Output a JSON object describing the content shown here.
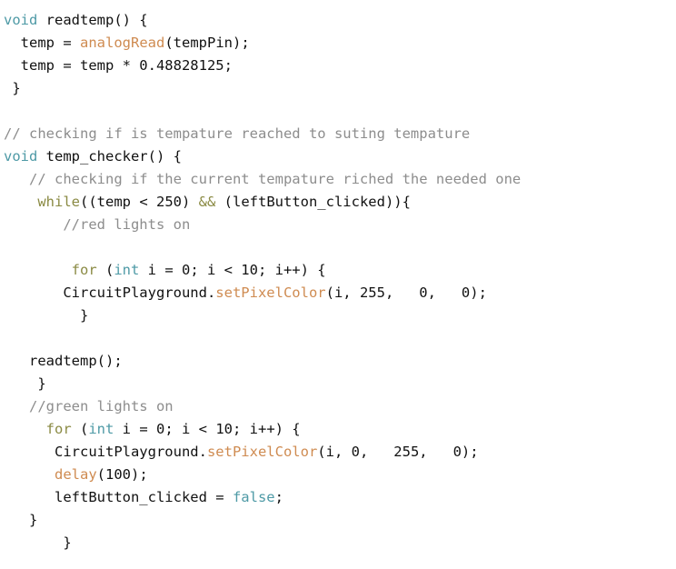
{
  "editor": {
    "language": "arduino-cpp",
    "background_color": "#ffffff",
    "colors": {
      "plain": "#111111",
      "keyword": "#4e9aa6",
      "control": "#8a8a43",
      "function": "#cf8b51",
      "comment": "#8d8d8d",
      "literal": "#4e9aa6"
    },
    "lines": [
      {
        "id": 1,
        "tokens": [
          {
            "t": "void",
            "c": "keyword"
          },
          {
            "t": " readtemp() {",
            "c": "plain"
          }
        ]
      },
      {
        "id": 2,
        "tokens": [
          {
            "t": "  temp = ",
            "c": "plain"
          },
          {
            "t": "analogRead",
            "c": "function"
          },
          {
            "t": "(tempPin);",
            "c": "plain"
          }
        ]
      },
      {
        "id": 3,
        "tokens": [
          {
            "t": "  temp = temp * 0.48828125;",
            "c": "plain"
          }
        ]
      },
      {
        "id": 4,
        "tokens": [
          {
            "t": " }",
            "c": "plain"
          }
        ]
      },
      {
        "id": 5,
        "tokens": []
      },
      {
        "id": 6,
        "tokens": [
          {
            "t": "// checking if is tempature reached to suting tempature",
            "c": "comment"
          }
        ]
      },
      {
        "id": 7,
        "tokens": [
          {
            "t": "void",
            "c": "keyword"
          },
          {
            "t": " temp_checker() {",
            "c": "plain"
          }
        ]
      },
      {
        "id": 8,
        "tokens": [
          {
            "t": "   // checking if the current tempature riched the needed one",
            "c": "comment"
          }
        ]
      },
      {
        "id": 9,
        "tokens": [
          {
            "t": "    ",
            "c": "plain"
          },
          {
            "t": "while",
            "c": "control"
          },
          {
            "t": "((temp < 250) ",
            "c": "plain"
          },
          {
            "t": "&&",
            "c": "control"
          },
          {
            "t": " (leftButton_clicked)){",
            "c": "plain"
          }
        ]
      },
      {
        "id": 10,
        "tokens": [
          {
            "t": "       //red lights on",
            "c": "comment"
          }
        ]
      },
      {
        "id": 11,
        "tokens": []
      },
      {
        "id": 12,
        "tokens": [
          {
            "t": "        ",
            "c": "plain"
          },
          {
            "t": "for",
            "c": "control"
          },
          {
            "t": " (",
            "c": "plain"
          },
          {
            "t": "int",
            "c": "keyword"
          },
          {
            "t": " i = 0; i < 10; i++) {",
            "c": "plain"
          }
        ]
      },
      {
        "id": 13,
        "tokens": [
          {
            "t": "       CircuitPlayground.",
            "c": "plain"
          },
          {
            "t": "setPixelColor",
            "c": "function"
          },
          {
            "t": "(i, 255,   0,   0);",
            "c": "plain"
          }
        ]
      },
      {
        "id": 14,
        "tokens": [
          {
            "t": "         }",
            "c": "plain"
          }
        ]
      },
      {
        "id": 15,
        "tokens": []
      },
      {
        "id": 16,
        "tokens": [
          {
            "t": "   readtemp();",
            "c": "plain"
          }
        ]
      },
      {
        "id": 17,
        "tokens": [
          {
            "t": "    }",
            "c": "plain"
          }
        ]
      },
      {
        "id": 18,
        "tokens": [
          {
            "t": "   //green lights on",
            "c": "comment"
          }
        ]
      },
      {
        "id": 19,
        "tokens": [
          {
            "t": "     ",
            "c": "plain"
          },
          {
            "t": "for",
            "c": "control"
          },
          {
            "t": " (",
            "c": "plain"
          },
          {
            "t": "int",
            "c": "keyword"
          },
          {
            "t": " i = 0; i < 10; i++) {",
            "c": "plain"
          }
        ]
      },
      {
        "id": 20,
        "tokens": [
          {
            "t": "      CircuitPlayground.",
            "c": "plain"
          },
          {
            "t": "setPixelColor",
            "c": "function"
          },
          {
            "t": "(i, 0,   255,   0);",
            "c": "plain"
          }
        ]
      },
      {
        "id": 21,
        "tokens": [
          {
            "t": "      ",
            "c": "plain"
          },
          {
            "t": "delay",
            "c": "function"
          },
          {
            "t": "(100);",
            "c": "plain"
          }
        ]
      },
      {
        "id": 22,
        "tokens": [
          {
            "t": "      leftButton_clicked = ",
            "c": "plain"
          },
          {
            "t": "false",
            "c": "literal"
          },
          {
            "t": ";",
            "c": "plain"
          }
        ]
      },
      {
        "id": 23,
        "tokens": [
          {
            "t": "   }",
            "c": "plain"
          }
        ]
      },
      {
        "id": 24,
        "tokens": [
          {
            "t": "       }",
            "c": "plain"
          }
        ]
      }
    ]
  }
}
